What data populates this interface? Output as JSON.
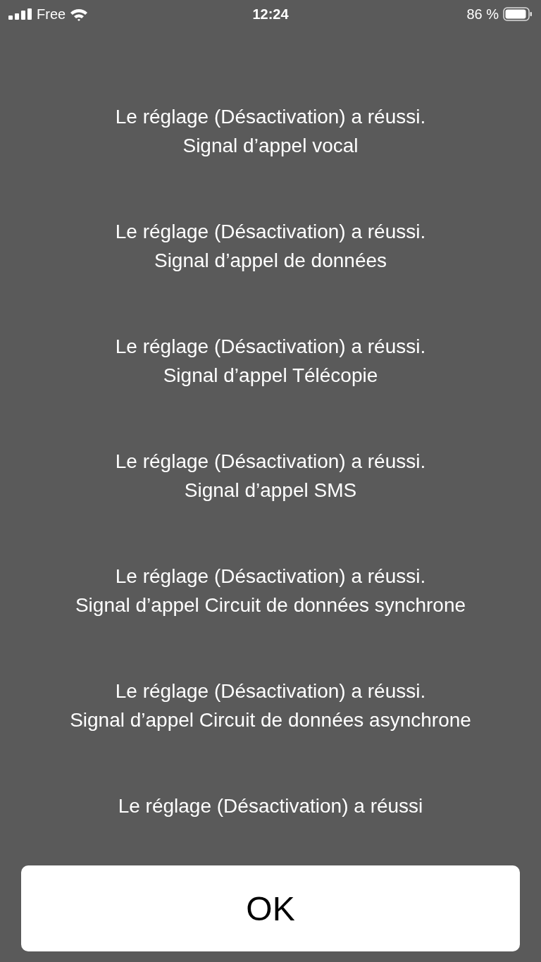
{
  "status_bar": {
    "carrier": "Free",
    "time": "12:24",
    "battery": "86 %"
  },
  "messages": [
    {
      "lines": [
        "Le réglage (Désactivation) a réussi.",
        "Signal d’appel vocal"
      ]
    },
    {
      "lines": [
        "Le réglage (Désactivation) a réussi.",
        "Signal d’appel de données"
      ]
    },
    {
      "lines": [
        "Le réglage (Désactivation) a réussi.",
        "Signal d’appel Télécopie"
      ]
    },
    {
      "lines": [
        "Le réglage (Désactivation) a réussi.",
        "Signal d’appel SMS"
      ]
    },
    {
      "lines": [
        "Le réglage (Désactivation) a réussi.",
        "Signal d’appel Circuit de données synchrone"
      ]
    },
    {
      "lines": [
        "Le réglage (Désactivation) a réussi.",
        "Signal d’appel Circuit de données asynchrone"
      ]
    },
    {
      "lines": [
        "Le réglage (Désactivation) a réussi"
      ]
    }
  ],
  "button": {
    "label": "OK"
  }
}
